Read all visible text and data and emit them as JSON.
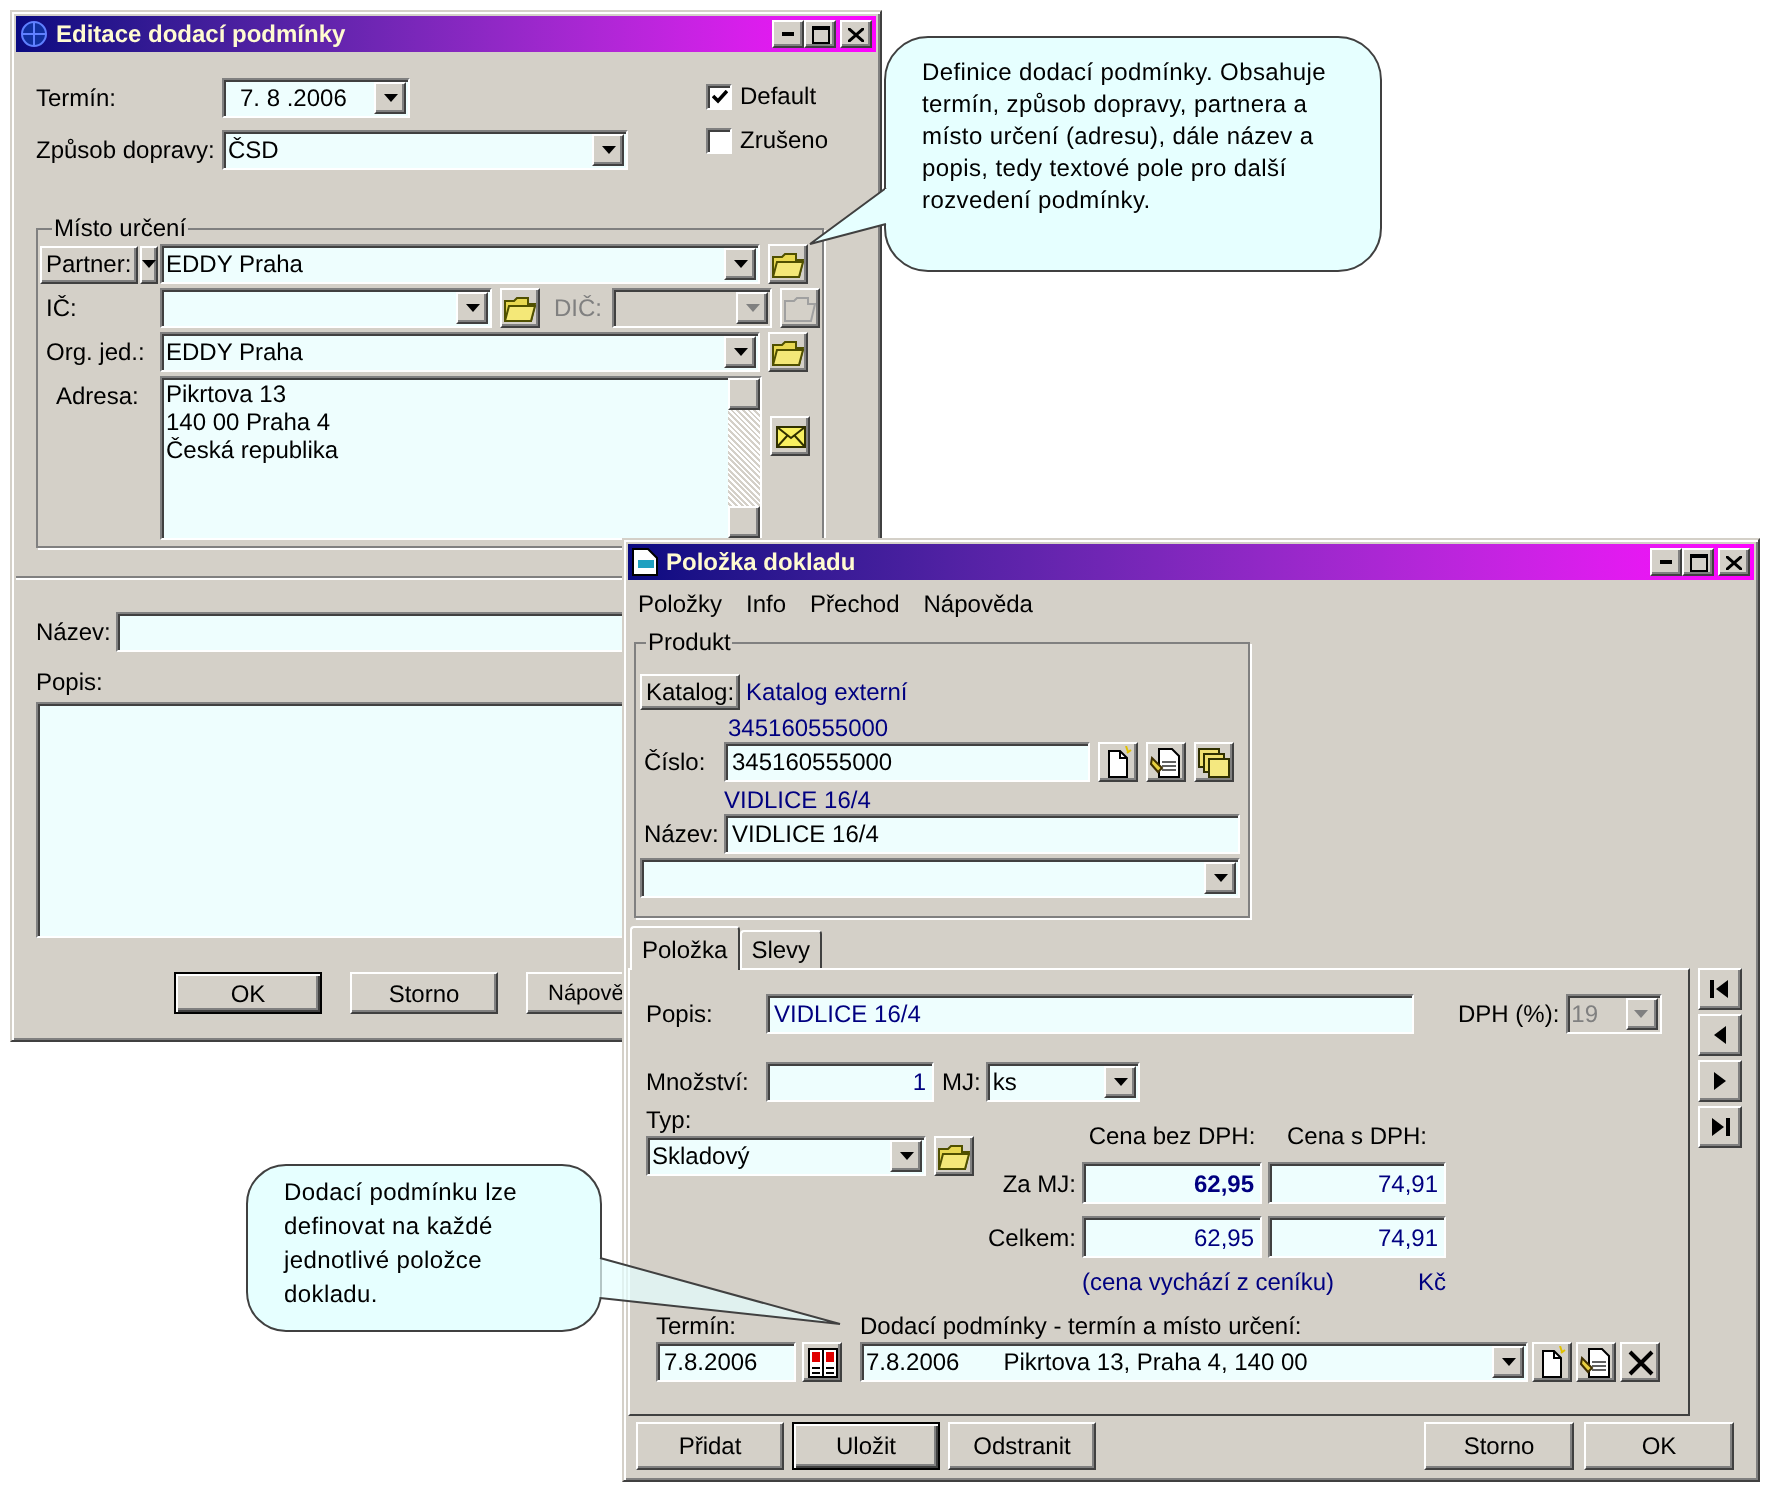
{
  "delivery_dialog": {
    "title": "Editace dodací podmínky",
    "term": {
      "label": "Termín:",
      "value": "7. 8 .2006"
    },
    "transport": {
      "label": "Způsob dopravy:",
      "value": "ČSD"
    },
    "checkboxes": [
      {
        "label": "Default",
        "checked": true
      },
      {
        "label": "Zrušeno",
        "checked": false
      }
    ],
    "destination": {
      "legend": "Místo určení",
      "partner_button": "Partner:",
      "partner": "EDDY Praha",
      "ic_label": "IČ:",
      "dic_label": "DIČ:",
      "dic_disabled": true,
      "org_label": "Org. jed.:",
      "org": "EDDY Praha",
      "address_label": "Adresa:",
      "address_lines": [
        "Pikrtova 13",
        "140 00 Praha 4",
        "Česká republika"
      ]
    },
    "name_label": "Název:",
    "description_label": "Popis:",
    "buttons": [
      {
        "label": "OK",
        "default": true
      },
      {
        "label": "Storno",
        "default": false
      },
      {
        "label": "Nápově",
        "default": false
      }
    ]
  },
  "item_dialog": {
    "title": "Položka dokladu",
    "menu": [
      "Položky",
      "Info",
      "Přechod",
      "Nápověda"
    ],
    "product": {
      "legend": "Produkt",
      "catalog_button": "Katalog:",
      "catalog": "Katalog externí",
      "number_hint": "345160555000",
      "number_label": "Číslo:",
      "number": "345160555000",
      "name_hint": "VIDLICE 16/4",
      "name_label": "Název:",
      "name": "VIDLICE 16/4"
    },
    "tabs": [
      {
        "label": "Položka",
        "selected": true
      },
      {
        "label": "Slevy",
        "selected": false
      }
    ],
    "description": {
      "label": "Popis:",
      "value": "VIDLICE 16/4"
    },
    "vat": {
      "label": "DPH (%):",
      "value": "19",
      "disabled": true
    },
    "quantity": {
      "label": "Množství:",
      "value": "1"
    },
    "unit": {
      "label": "MJ:",
      "value": "ks"
    },
    "type": {
      "label": "Typ:",
      "value": "Skladový"
    },
    "price_headers": [
      "Cena bez DPH:",
      "Cena s DPH:"
    ],
    "price_rows": [
      {
        "label": "Za MJ:",
        "net": "62,95",
        "gross": "74,91",
        "net_bold": true
      },
      {
        "label": "Celkem:",
        "net": "62,95",
        "gross": "74,91",
        "net_bold": false
      }
    ],
    "price_note": "(cena vychází z ceníku)",
    "currency": "Kč",
    "term": {
      "label": "Termín:",
      "value": "7.8.2006"
    },
    "delivery": {
      "label": "Dodací podmínky - termín a místo určení:",
      "date": "7.8.2006",
      "address": "Pikrtova 13, Praha 4, 140 00"
    },
    "buttons_left": [
      {
        "label": "Přidat",
        "default": false
      },
      {
        "label": "Uložit",
        "default": true
      },
      {
        "label": "Odstranit",
        "default": false
      }
    ],
    "buttons_right": [
      {
        "label": "Storno",
        "default": false
      },
      {
        "label": "OK",
        "default": false
      }
    ]
  },
  "callouts": [
    {
      "text": "Definice dodací podmínky. Obsahuje termín, způsob dopravy, partnera a místo určení (adresu), dále název a popis, tedy textové pole pro další rozvedení podmínky."
    },
    {
      "text": "Dodací podmínku lze definovat na každé jednotlivé položce dokladu."
    }
  ]
}
